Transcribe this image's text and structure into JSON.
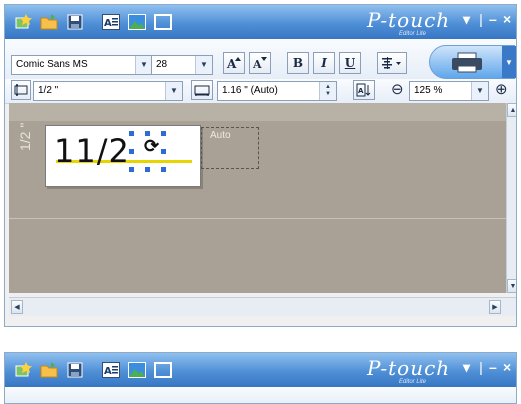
{
  "app": {
    "brand": "P-touch",
    "brand_sub": "Editor Lite"
  },
  "window_controls": [
    "▾",
    "–",
    "×"
  ],
  "toolbar": {
    "font": "Comic Sans MS",
    "font_size": "28",
    "bold": "B",
    "italic": "I",
    "underline": "U",
    "tape_width": "1/2 \"",
    "length": "1.16 \" (Auto)",
    "zoom": "125 %",
    "zoom_out": "⊖",
    "zoom_in": "⊕"
  },
  "canvas": {
    "tape_label": "1/2 \"",
    "text": "11/2",
    "auto_text": "Auto"
  },
  "colors": {
    "title_bar": "#4f8fd6",
    "canvas_bg": "#a9a195",
    "handle": "#2e6bd9",
    "highlight": "#e8d400"
  }
}
